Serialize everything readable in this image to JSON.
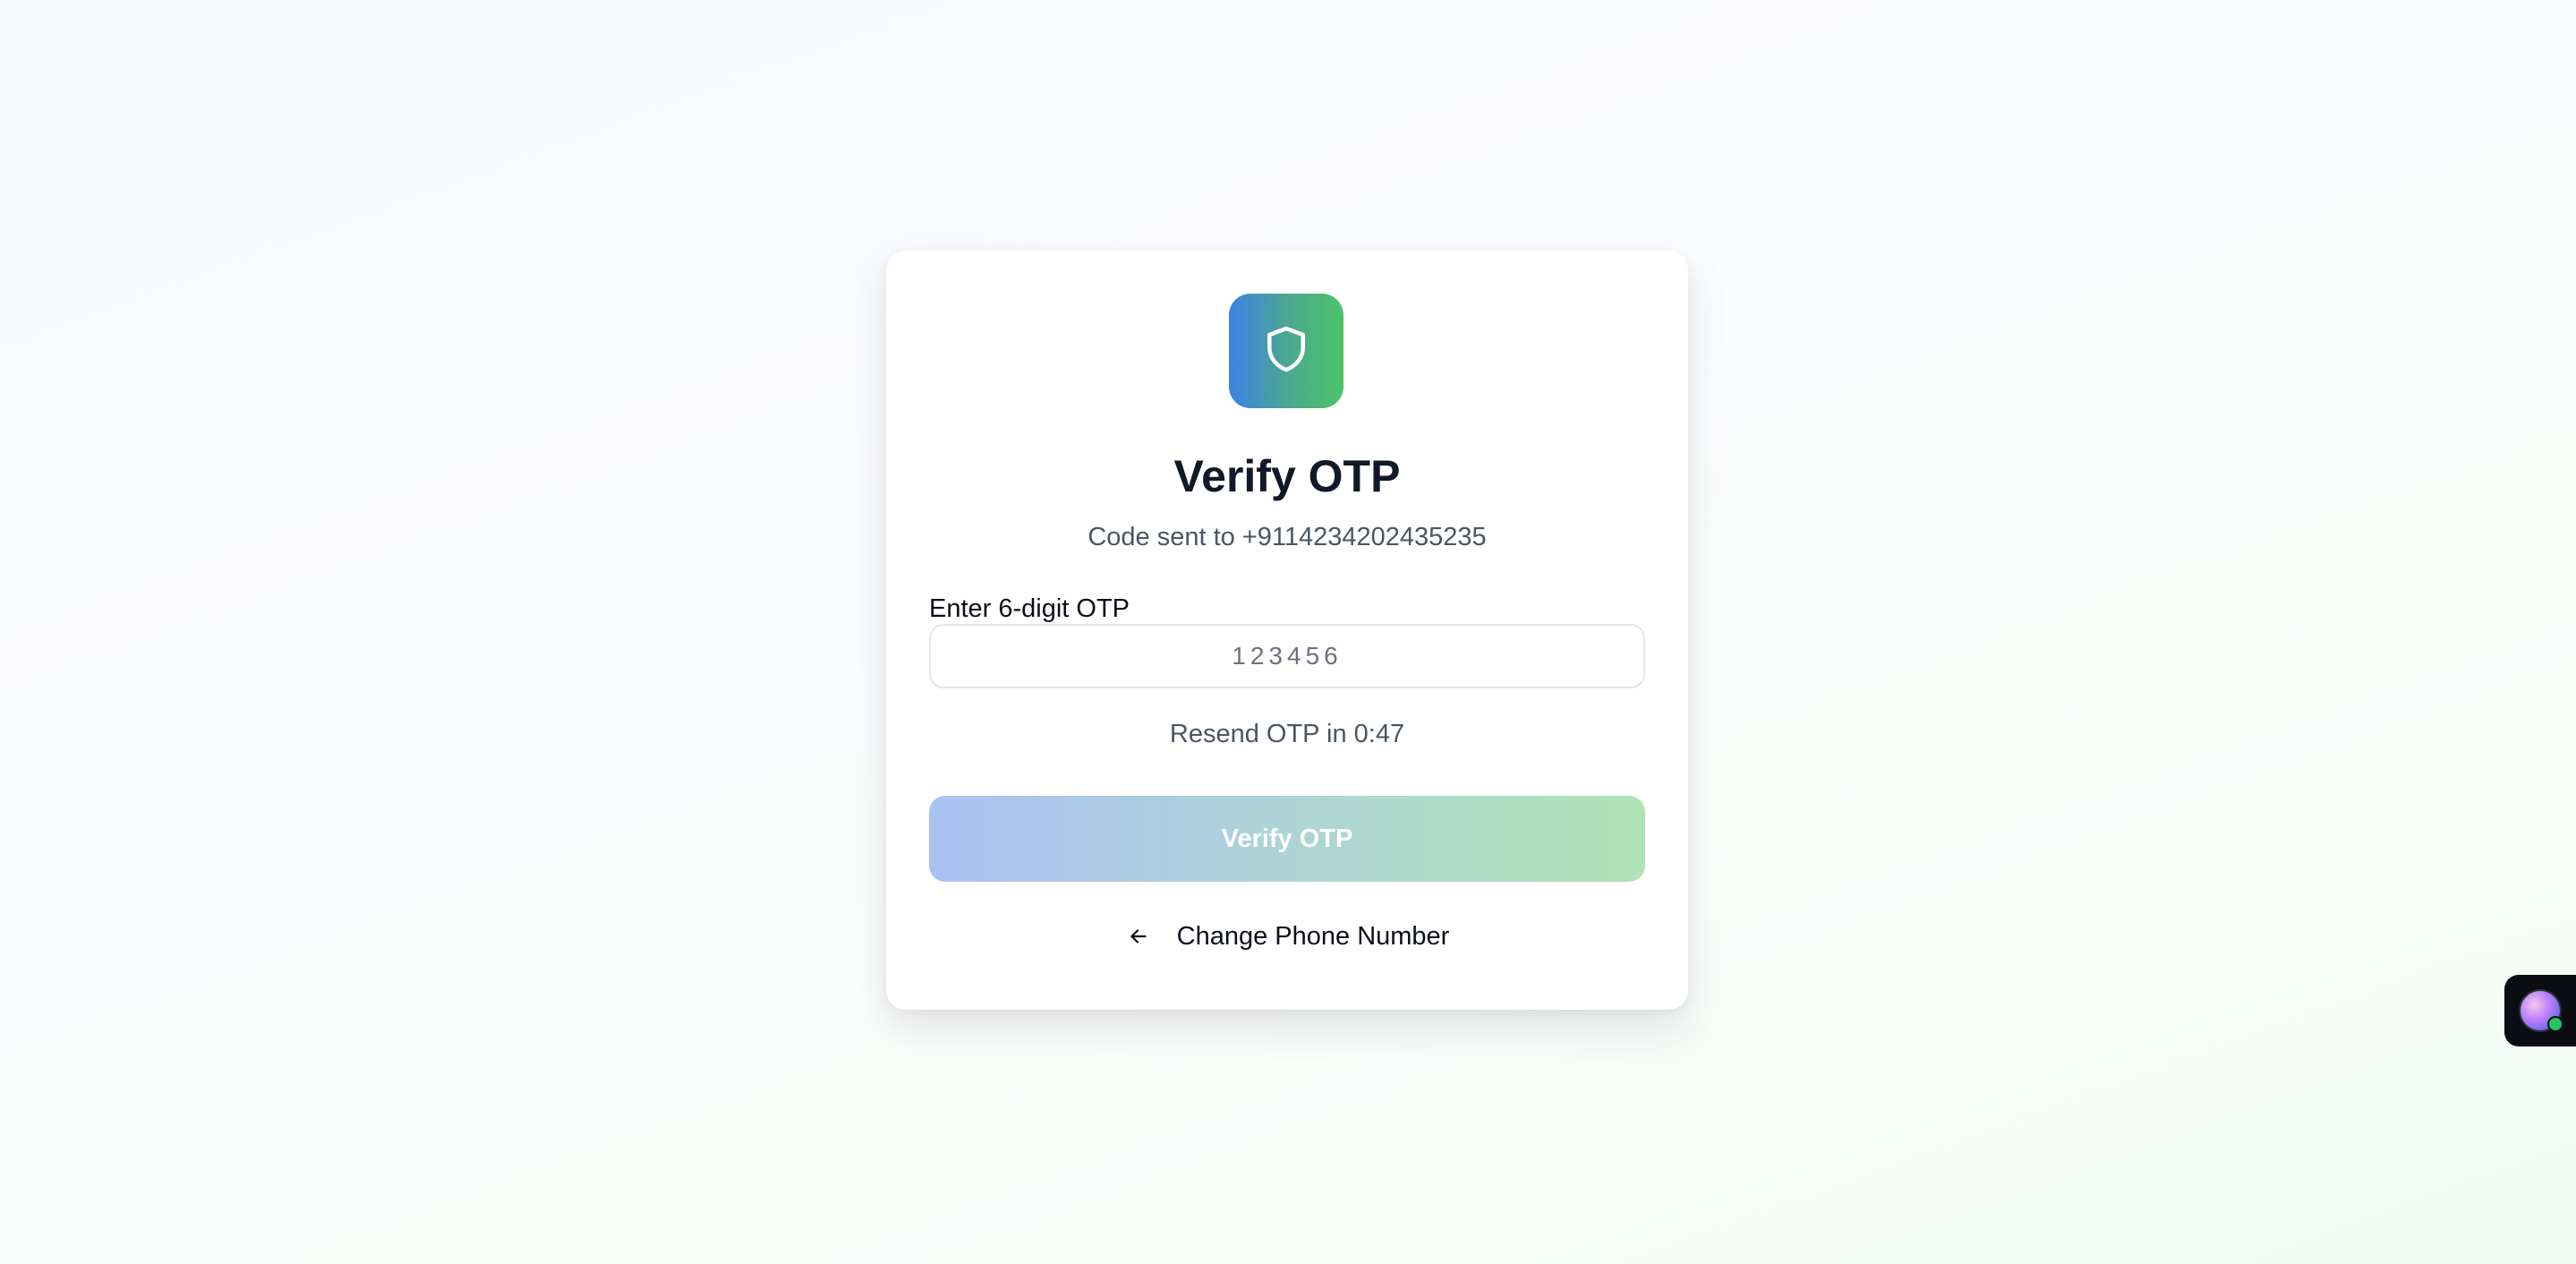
{
  "card": {
    "title": "Verify OTP",
    "subtitle": "Code sent to +9114234202435235",
    "otp_label": "Enter 6-digit OTP",
    "otp_placeholder": "123456",
    "otp_value": "",
    "resend_text": "Resend OTP in 0:47",
    "verify_button_label": "Verify OTP",
    "change_phone_label": "Change Phone Number"
  },
  "icons": {
    "logo": "shield-icon",
    "back": "arrow-left-icon",
    "widget": "avatar"
  },
  "colors": {
    "logo_gradient": [
      "#3b82e6",
      "#4cc36a"
    ],
    "verify_button_gradient": [
      "#a9c2f4",
      "#afe3b3"
    ],
    "title_color": "#111827",
    "widget_status": "#22c55e"
  },
  "state": {
    "verify_button_disabled": true
  }
}
